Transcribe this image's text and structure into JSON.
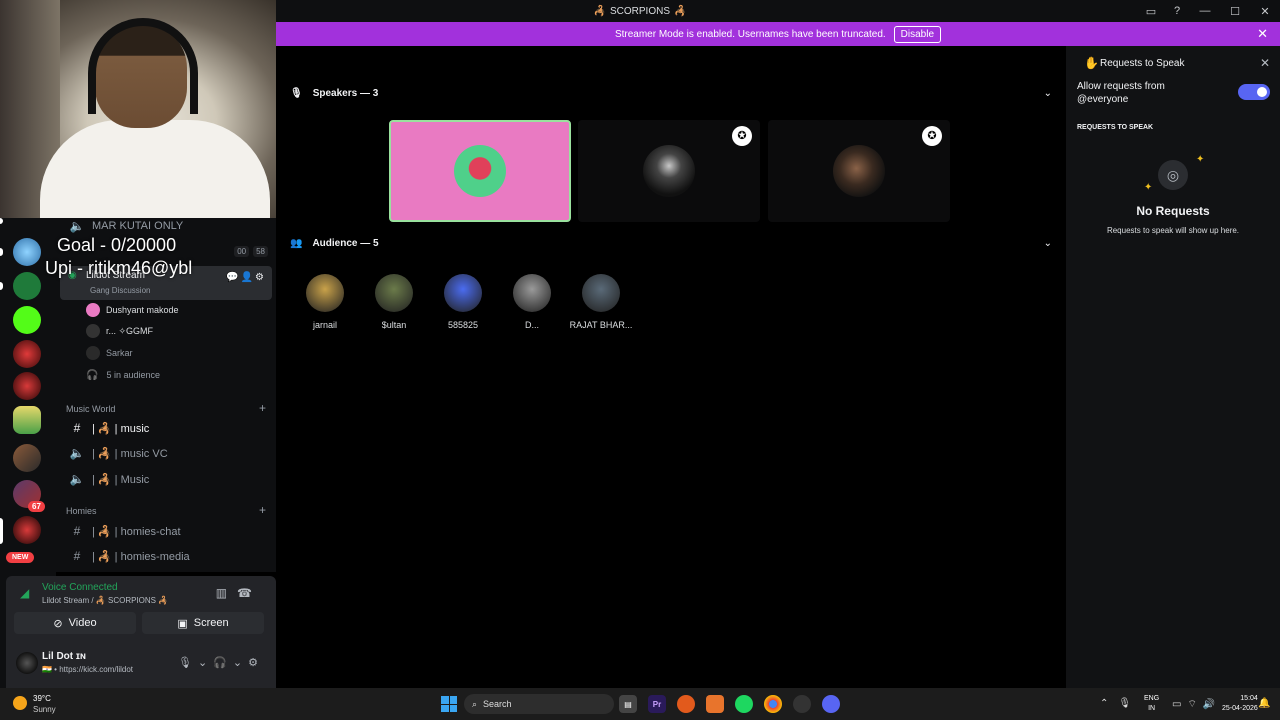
{
  "window": {
    "title": "SCORPIONS",
    "emoji_glyph": "🦂"
  },
  "banner": {
    "text": "Streamer Mode is enabled. Usernames have been truncated.",
    "button": "Disable"
  },
  "overlay": {
    "goal": "Goal - 0/20000",
    "upi": "Upi - ritikm46@ybl"
  },
  "guild_rail": {
    "unread_count": "67",
    "new_badge": "NEW"
  },
  "channels": {
    "truncated_top": "MAR KUTAI ONLY",
    "mutual": [
      "00",
      "58"
    ],
    "stage": {
      "name": "Lildot Stream",
      "topic": "Gang Discussion"
    },
    "members": [
      {
        "name": "Dushyant makode"
      },
      {
        "name": "r... ✧GGMF"
      },
      {
        "name": "Sarkar"
      }
    ],
    "audience": "5 in audience",
    "categories": [
      {
        "name": "Music World",
        "channels": [
          {
            "type": "text",
            "name": "| 🦂 | music"
          },
          {
            "type": "voice",
            "name": "| 🦂 | music VC"
          },
          {
            "type": "voice",
            "name": "| 🦂 | Music"
          }
        ]
      },
      {
        "name": "Homies",
        "channels": [
          {
            "type": "text",
            "name": "| 🦂 | homies-chat"
          },
          {
            "type": "text",
            "name": "| 🦂 | homies-media"
          }
        ]
      }
    ]
  },
  "voice": {
    "status": "Voice Connected",
    "location": "Lildot Stream / 🦂 SCORPIONS 🦂",
    "video_label": "Video",
    "screen_label": "Screen"
  },
  "user": {
    "name": "Lil Dot ɪɴ",
    "status": "🇮🇳 • https://kick.com/lildot"
  },
  "stage_view": {
    "speakers_heading": "Speakers — 3",
    "audience_heading": "Audience — 5",
    "audience": [
      {
        "name": "jarnail",
        "color": "#c9a24a"
      },
      {
        "name": "$ultan",
        "color": "#6b7b4a"
      },
      {
        "name": "585825",
        "color": "#4b6cf0"
      },
      {
        "name": "D...",
        "color": "#9a9a9a"
      },
      {
        "name": "RAJAT BHAR...",
        "color": "#5a6a78"
      }
    ]
  },
  "requests": {
    "title": "Requests to Speak",
    "allow_label": "Allow requests from @everyone",
    "section": "REQUESTS TO SPEAK",
    "empty_title": "No Requests",
    "empty_sub": "Requests to speak will show up here."
  },
  "taskbar": {
    "temp": "39°C",
    "weather": "Sunny",
    "search_placeholder": "Search",
    "lang_1": "ENG",
    "lang_2": "IN",
    "time": "15:04",
    "date": "25-04-2026"
  },
  "colors": {
    "banner": "#a231dc",
    "toggle": "#5865f2",
    "voice_connected": "#23a55a",
    "active_speaker_bg": "#e97ac2"
  }
}
